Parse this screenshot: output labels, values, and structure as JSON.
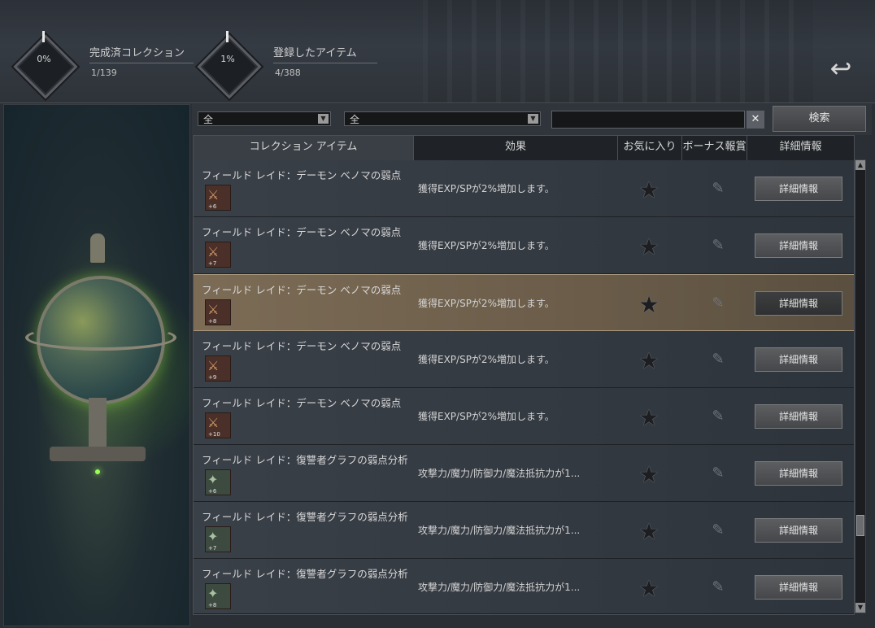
{
  "header": {
    "completed": {
      "percent": "0%",
      "label": "完成済コレクション",
      "value": "1/139"
    },
    "registered": {
      "percent": "1%",
      "label": "登録したアイテム",
      "value": "4/388"
    },
    "back_icon": "back-arrow-icon"
  },
  "filters": {
    "select1": "全",
    "select2": "全",
    "search_value": "",
    "search_button": "検索",
    "clear_icon": "close-icon"
  },
  "table": {
    "headers": [
      "コレクション アイテム",
      "効果",
      "お気に入り",
      "ボーナス報賞",
      "詳細情報"
    ],
    "detail_label": "詳細情報",
    "rows": [
      {
        "name": "フィールド レイド：デーモン ベノマの弱点",
        "effect": "獲得EXP/SPが2%増加します。",
        "badge": "+6"
      },
      {
        "name": "フィールド レイド：デーモン ベノマの弱点",
        "effect": "獲得EXP/SPが2%増加します。",
        "badge": "+7"
      },
      {
        "name": "フィールド レイド：デーモン ベノマの弱点",
        "effect": "獲得EXP/SPが2%増加します。",
        "badge": "+8"
      },
      {
        "name": "フィールド レイド：デーモン ベノマの弱点",
        "effect": "獲得EXP/SPが2%増加します。",
        "badge": "+9"
      },
      {
        "name": "フィールド レイド：デーモン ベノマの弱点",
        "effect": "獲得EXP/SPが2%増加します。",
        "badge": "+10"
      },
      {
        "name": "フィールド レイド：復讐者グラフの弱点分析",
        "effect": "攻撃力/魔力/防御力/魔法抵抗力が1...",
        "badge": "+6"
      },
      {
        "name": "フィールド レイド：復讐者グラフの弱点分析",
        "effect": "攻撃力/魔力/防御力/魔法抵抗力が1...",
        "badge": "+7"
      },
      {
        "name": "フィールド レイド：復讐者グラフの弱点分析",
        "effect": "攻撃力/魔力/防御力/魔法抵抗力が1...",
        "badge": "+8"
      }
    ]
  }
}
